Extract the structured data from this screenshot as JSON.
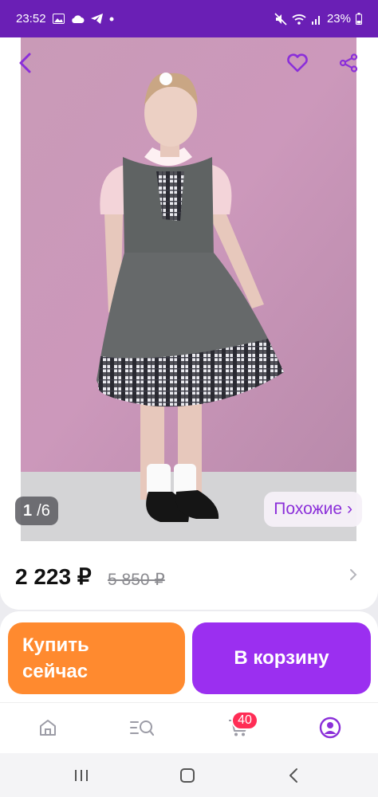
{
  "status_bar": {
    "time": "23:52",
    "battery": "23%",
    "icons": [
      "image-icon",
      "cloud-icon",
      "telegram-icon",
      "dot-icon",
      "mute-icon",
      "wifi-icon",
      "signal-icon",
      "battery-icon"
    ]
  },
  "product": {
    "image_counter_current": "1",
    "image_counter_sep": "/ ",
    "image_counter_total": "6",
    "similar_label": "Похожие",
    "similar_chevron": "›",
    "price": "2 223 ₽",
    "old_price": "5 850 ₽"
  },
  "actions": {
    "buy_now_line1": "Купить",
    "buy_now_line2": "сейчас",
    "add_to_cart": "В корзину"
  },
  "tabbar": {
    "items": [
      "home-icon",
      "catalog-search-icon",
      "cart-icon",
      "profile-icon"
    ],
    "cart_badge": "40"
  },
  "colors": {
    "brand_purple": "#6a1fb5",
    "accent_orange": "#ff8a2f",
    "accent_violet": "#9b2ff0",
    "badge_red": "#ff2d55"
  }
}
